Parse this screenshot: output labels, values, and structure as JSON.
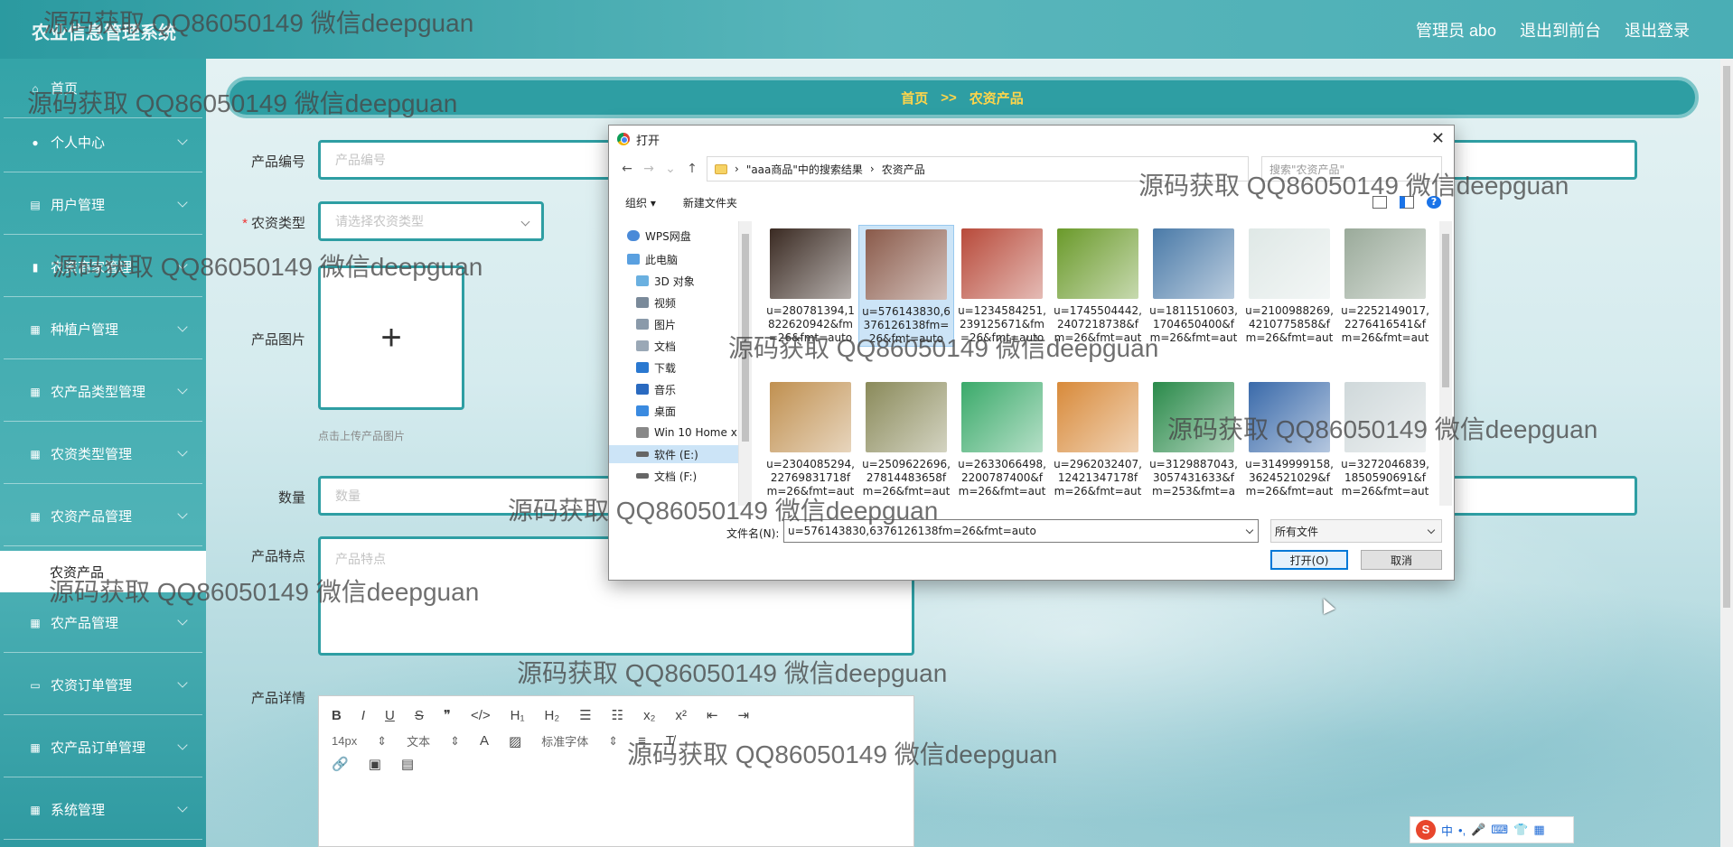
{
  "app": {
    "title": "农业信息管理系统"
  },
  "top_links": {
    "admin": "管理员 abo",
    "to_front": "退出到前台",
    "logout": "退出登录"
  },
  "sidebar": {
    "items": [
      {
        "label": "首页",
        "icon": "home-icon"
      },
      {
        "label": "个人中心",
        "icon": "person-icon"
      },
      {
        "label": "用户管理",
        "icon": "clipboard-icon"
      },
      {
        "label": "农资商家管理",
        "icon": "bar-chart-icon"
      },
      {
        "label": "种植户管理",
        "icon": "grid-icon"
      },
      {
        "label": "农产品类型管理",
        "icon": "grid-icon"
      },
      {
        "label": "农资类型管理",
        "icon": "grid-icon"
      },
      {
        "label": "农资产品管理",
        "icon": "grid-icon"
      },
      {
        "label": "农产品管理",
        "icon": "grid-icon"
      },
      {
        "label": "农资订单管理",
        "icon": "monitor-icon"
      },
      {
        "label": "农产品订单管理",
        "icon": "grid-icon"
      },
      {
        "label": "系统管理",
        "icon": "grid-icon"
      }
    ],
    "active_sub": "农资产品"
  },
  "breadcrumb": {
    "home": "首页",
    "sep": ">>",
    "current": "农资产品"
  },
  "form": {
    "code_label": "产品编号",
    "code_placeholder": "产品编号",
    "type_label": "农资类型",
    "type_placeholder": "请选择农资类型",
    "image_label": "产品图片",
    "image_hint": "点击上传产品图片",
    "qty_label": "数量",
    "qty_placeholder": "数量",
    "feature_label": "产品特点",
    "feature_placeholder": "产品特点",
    "detail_label": "产品详情"
  },
  "editor": {
    "font_size": "14px",
    "text_style": "文本",
    "font_family": "标准字体"
  },
  "dialog": {
    "title": "打开",
    "path": [
      "\"aaa商品\"中的搜索结果",
      "农资产品"
    ],
    "search_placeholder": "搜索\"农资产品\"",
    "organize": "组织 ▾",
    "new_folder": "新建文件夹",
    "tree": [
      {
        "label": "WPS网盘"
      },
      {
        "label": "此电脑"
      },
      {
        "label": "3D 对象"
      },
      {
        "label": "视频"
      },
      {
        "label": "图片"
      },
      {
        "label": "文档"
      },
      {
        "label": "下载"
      },
      {
        "label": "音乐"
      },
      {
        "label": "桌面"
      },
      {
        "label": "Win 10 Home x"
      },
      {
        "label": "软件 (E:)"
      },
      {
        "label": "文档 (F:)"
      }
    ],
    "files": [
      {
        "name": "u=280781394,1822620942&fm=26&fmt=auto",
        "line1": "u=280781394,1",
        "line2": "822620942&fm",
        "line3": "=26&fmt=auto",
        "color": "#3a2a22"
      },
      {
        "name": "u=576143830,6376126138fm=26&fmt=auto",
        "line1": "u=576143830,6",
        "line2": "376126138fm=",
        "line3": "26&fmt=auto",
        "color": "#8a5a4a"
      },
      {
        "name": "u=1234584251,239125671&fm=26&fmt=auto",
        "line1": "u=1234584251,",
        "line2": "239125671&fm",
        "line3": "=26&fmt=auto",
        "color": "#b84a3a"
      },
      {
        "name": "u=1745504442,2407218738&fm=26&fmt=auto",
        "line1": "u=1745504442,",
        "line2": "2407218738&f",
        "line3": "m=26&fmt=aut",
        "color": "#6a9a2a"
      },
      {
        "name": "u=1811510603,1704650400&fm=26&fmt=auto",
        "line1": "u=1811510603,",
        "line2": "1704650400&f",
        "line3": "m=26&fmt=aut",
        "color": "#4a7aa8"
      },
      {
        "name": "u=2100988269,4210775858&fm=26&fmt=auto",
        "line1": "u=2100988269,",
        "line2": "4210775858&f",
        "line3": "m=26&fmt=aut",
        "color": "#dfe8e6"
      },
      {
        "name": "u=2252149017,2276416541&fm=26&fmt=auto",
        "line1": "u=2252149017,",
        "line2": "2276416541&f",
        "line3": "m=26&fmt=aut",
        "color": "#9aaa9a"
      },
      {
        "name": "u=2304085294,2276983171&fm=26",
        "line1": "u=2304085294,",
        "line2": "22769831718f",
        "line3": "m=26&fmt=aut",
        "color": "#c09050"
      },
      {
        "name": "u=2509622696,2781448365&fm=26",
        "line1": "u=2509622696,",
        "line2": "27814483658f",
        "line3": "m=26&fmt=aut",
        "color": "#8a8a5a"
      },
      {
        "name": "u=2633066498,2200787400&fm=26",
        "line1": "u=2633066498,",
        "line2": "2200787400&f",
        "line3": "m=26&fmt=aut",
        "color": "#3aaa6a"
      },
      {
        "name": "u=2962032407,1242134717&fm=26",
        "line1": "u=2962032407,",
        "line2": "12421347178f",
        "line3": "m=26&fmt=aut",
        "color": "#d88a3a"
      },
      {
        "name": "u=3129887043,3057431633&fm=253",
        "line1": "u=3129887043,",
        "line2": "3057431633&f",
        "line3": "m=253&fmt=a",
        "color": "#2a8a4a"
      },
      {
        "name": "u=3149999158,3624521029&fm=26",
        "line1": "u=3149999158,",
        "line2": "3624521029&f",
        "line3": "m=26&fmt=aut",
        "color": "#3a6aaa"
      },
      {
        "name": "u=3272046839,1850590691&fm=26",
        "line1": "u=3272046839,",
        "line2": "1850590691&f",
        "line3": "m=26&fmt=aut",
        "color": "#cfd8da"
      }
    ],
    "filename_label": "文件名(N):",
    "filename_value": "u=576143830,6376126138fm=26&fmt=auto",
    "filetype": "所有文件",
    "open_button": "打开(O)",
    "cancel_button": "取消"
  },
  "watermark": "源码获取 QQ86050149 微信deepguan",
  "ime": {
    "label": "中"
  }
}
